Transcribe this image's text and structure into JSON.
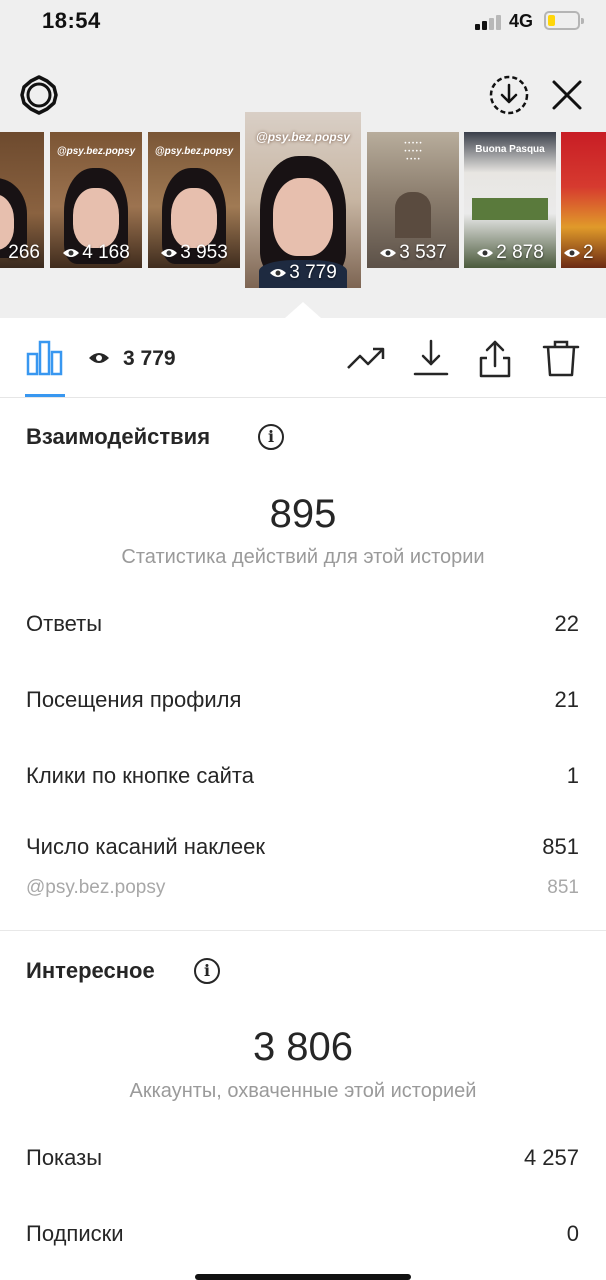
{
  "status_bar": {
    "time": "18:54",
    "network": "4G",
    "battery_color": "#ffd60a"
  },
  "icons": {
    "settings": "gear-icon",
    "download_circle": "download-circle-icon",
    "close": "close-icon",
    "insights": "bar-chart-icon",
    "views": "eye-icon",
    "promote": "trend-up-icon",
    "save": "download-icon",
    "share": "share-icon",
    "delete": "trash-icon",
    "info": "info-icon"
  },
  "stories": [
    {
      "views": "266",
      "overlay": ""
    },
    {
      "views": "4 168",
      "overlay": "@psy.bez.popsy"
    },
    {
      "views": "3 953",
      "overlay": "@psy.bez.popsy"
    },
    {
      "views": "3 779",
      "overlay": "@psy.bez.popsy",
      "active": true
    },
    {
      "views": "3 537",
      "overlay": ""
    },
    {
      "views": "2 878",
      "overlay": "Buona Pasqua"
    },
    {
      "views": "2",
      "overlay": ""
    }
  ],
  "toolbar": {
    "views_total": "3 779"
  },
  "interactions": {
    "title": "Взаимодействия",
    "total": "895",
    "caption": "Статистика действий для этой истории",
    "rows": [
      {
        "label": "Ответы",
        "value": "22"
      },
      {
        "label": "Посещения профиля",
        "value": "21"
      },
      {
        "label": "Клики по кнопке сайта",
        "value": "1"
      },
      {
        "label": "Число касаний наклеек",
        "value": "851"
      }
    ],
    "sub_row": {
      "label": "@psy.bez.popsy",
      "value": "851"
    }
  },
  "discovery": {
    "title": "Интересное",
    "total": "3 806",
    "caption": "Аккаунты, охваченные этой историей",
    "rows": [
      {
        "label": "Показы",
        "value": "4 257"
      },
      {
        "label": "Подписки",
        "value": "0"
      }
    ]
  },
  "colors": {
    "accent": "#3897f0",
    "text": "#262626",
    "muted": "#9a9a9a"
  }
}
